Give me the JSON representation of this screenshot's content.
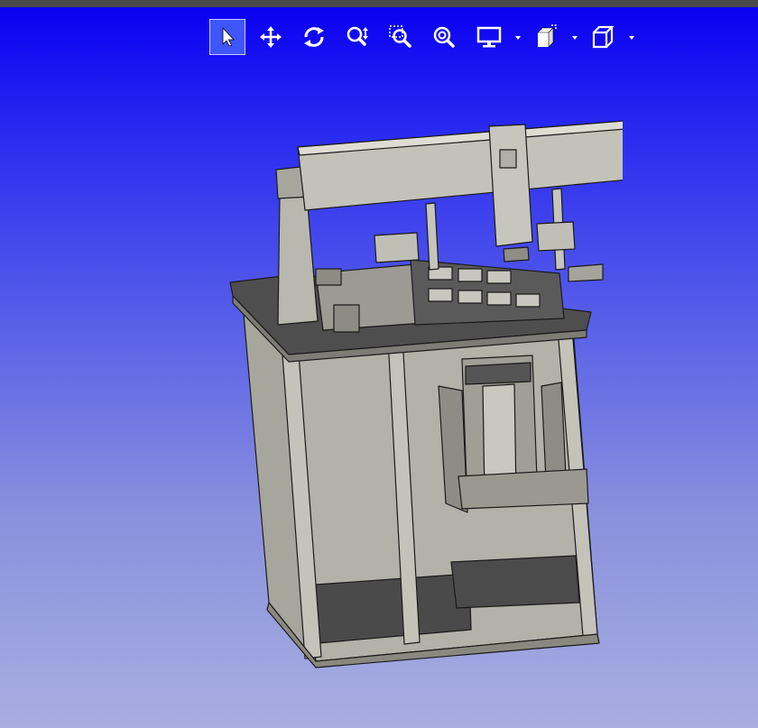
{
  "toolbar": {
    "tools": [
      {
        "icon": "select-arrow-icon",
        "active": true
      },
      {
        "icon": "pan-move-icon",
        "active": false
      },
      {
        "icon": "rotate-orbit-icon",
        "active": false
      },
      {
        "icon": "zoom-in-out-icon",
        "active": false
      },
      {
        "icon": "zoom-window-icon",
        "active": false
      },
      {
        "icon": "zoom-fit-icon",
        "active": false
      },
      {
        "icon": "display-mode-icon",
        "active": false,
        "has_dropdown": true
      },
      {
        "icon": "section-view-icon",
        "active": false,
        "has_dropdown": true
      },
      {
        "icon": "view-cube-icon",
        "active": false,
        "has_dropdown": true
      }
    ]
  },
  "colors": {
    "topbar": "#4a4a4a",
    "background_top": "#0a00f2",
    "background_bottom": "#a8aee0",
    "model_face": "#b3b2a9",
    "model_dark": "#4a4a4a",
    "model_edge": "#1a1a1a",
    "icon": "#ffffff",
    "active_tool": "#3f56ff"
  }
}
